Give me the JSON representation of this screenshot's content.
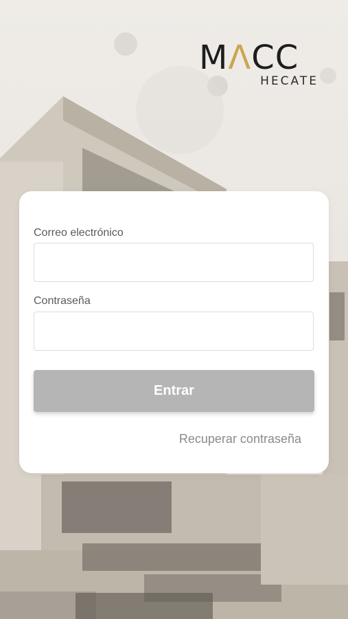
{
  "brand": {
    "name_prefix": "M",
    "name_accent": "Λ",
    "name_suffix": "CC",
    "subtitle": "HECATE"
  },
  "login": {
    "email_label": "Correo electrónico",
    "email_value": "",
    "password_label": "Contraseña",
    "password_value": "",
    "submit_label": "Entrar",
    "recover_link": "Recuperar contraseña"
  },
  "colors": {
    "accent": "#c9a64f",
    "button_disabled": "#b5b5b5",
    "card": "#ffffff"
  }
}
